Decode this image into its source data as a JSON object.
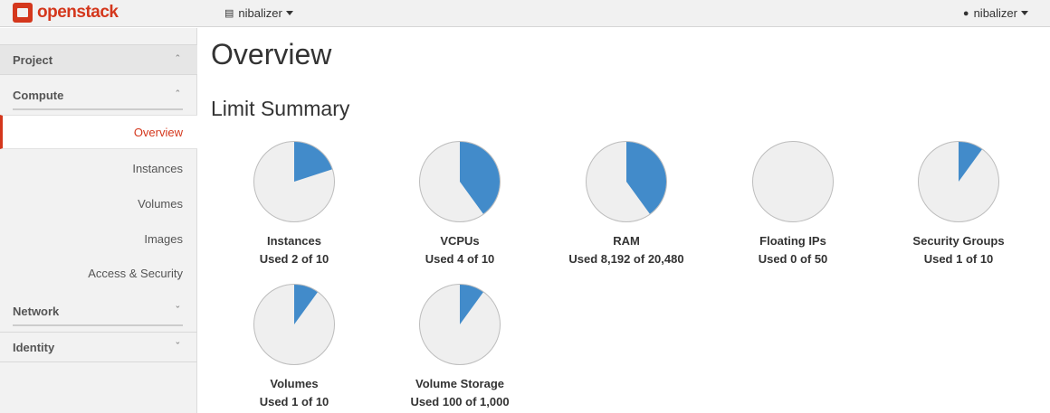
{
  "header": {
    "brand": "openstack",
    "project_selector": "nibalizer",
    "user_menu": "nibalizer"
  },
  "sidebar": {
    "project_label": "Project",
    "compute_label": "Compute",
    "items": [
      "Overview",
      "Instances",
      "Volumes",
      "Images",
      "Access & Security"
    ],
    "network_label": "Network",
    "identity_label": "Identity"
  },
  "main": {
    "title": "Overview",
    "section_title": "Limit Summary"
  },
  "colors": {
    "used": "#428bca",
    "free": "#efefef",
    "accent": "#d4371c"
  },
  "chart_data": [
    {
      "type": "pie",
      "title": "Instances",
      "used_label": "Used 2 of 10",
      "used": 2,
      "total": 10
    },
    {
      "type": "pie",
      "title": "VCPUs",
      "used_label": "Used 4 of 10",
      "used": 4,
      "total": 10
    },
    {
      "type": "pie",
      "title": "RAM",
      "used_label": "Used 8,192 of 20,480",
      "used": 8192,
      "total": 20480
    },
    {
      "type": "pie",
      "title": "Floating IPs",
      "used_label": "Used 0 of 50",
      "used": 0,
      "total": 50
    },
    {
      "type": "pie",
      "title": "Security Groups",
      "used_label": "Used 1 of 10",
      "used": 1,
      "total": 10
    },
    {
      "type": "pie",
      "title": "Volumes",
      "used_label": "Used 1 of 10",
      "used": 1,
      "total": 10
    },
    {
      "type": "pie",
      "title": "Volume Storage",
      "used_label": "Used 100 of 1,000",
      "used": 100,
      "total": 1000
    }
  ]
}
